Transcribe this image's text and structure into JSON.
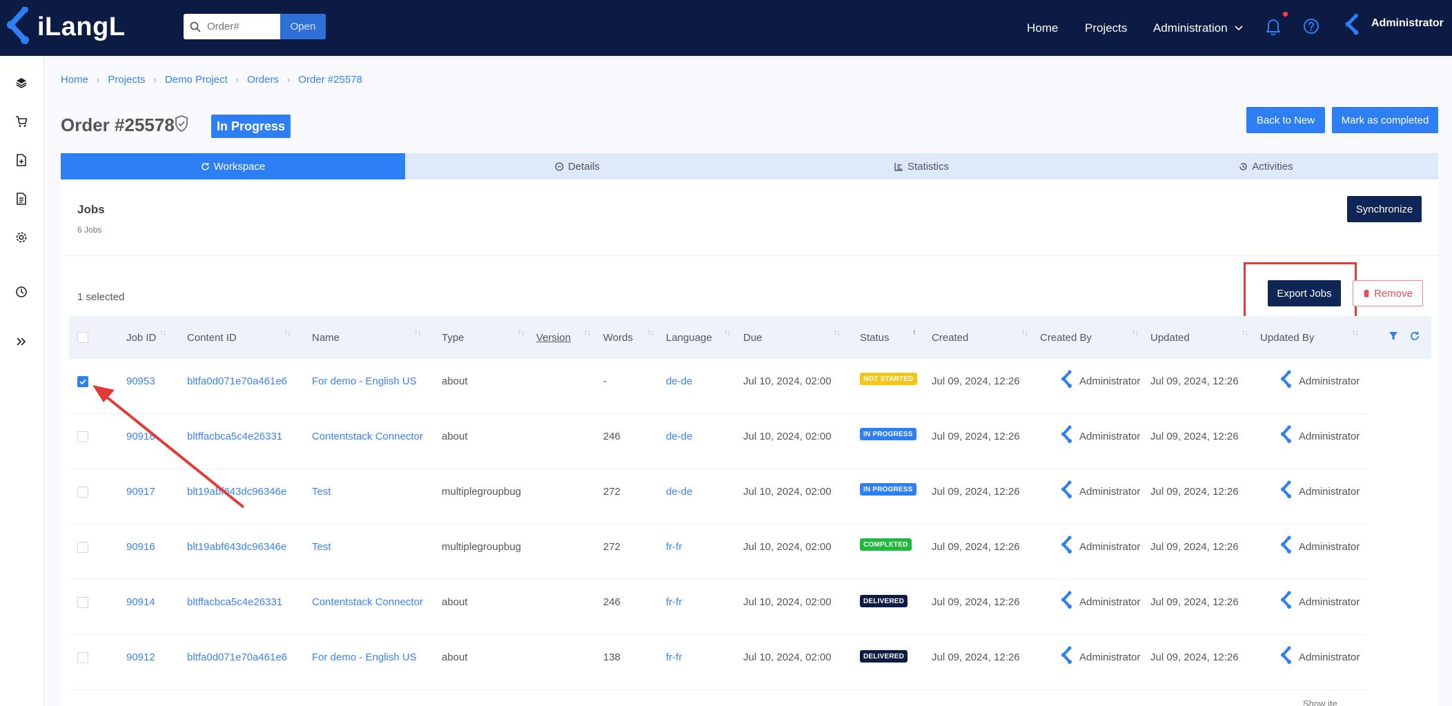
{
  "brand": {
    "name": "iLangL"
  },
  "search": {
    "placeholder": "Order#",
    "button": "Open"
  },
  "nav": {
    "home": "Home",
    "projects": "Projects",
    "administration": "Administration",
    "user": "Administrator"
  },
  "sidebar": {
    "icons": [
      "layers-icon",
      "cart-icon",
      "file-add-icon",
      "document-icon",
      "settings-icon",
      "clock-icon",
      "expand-icon"
    ]
  },
  "breadcrumb": [
    "Home",
    "Projects",
    "Demo Project",
    "Orders",
    "Order #25578"
  ],
  "order": {
    "title": "Order #25578",
    "status": "In Progress"
  },
  "actions": {
    "back_to_new": "Back to New",
    "mark_completed": "Mark as completed"
  },
  "tabs": [
    {
      "label": "Workspace",
      "icon": "sync-icon",
      "active": true
    },
    {
      "label": "Details",
      "icon": "circle-minus-icon",
      "active": false
    },
    {
      "label": "Statistics",
      "icon": "chart-icon",
      "active": false
    },
    {
      "label": "Activities",
      "icon": "history-icon",
      "active": false
    }
  ],
  "jobs": {
    "title": "Jobs",
    "count": "6 Jobs",
    "synchronize": "Synchronize",
    "selected": "1 selected",
    "export": "Export Jobs",
    "remove": "Remove",
    "columns": [
      "Job ID",
      "Content ID",
      "Name",
      "Type",
      "Version",
      "Words",
      "Language",
      "Due",
      "Status",
      "Created",
      "Created By",
      "Updated",
      "Updated By"
    ],
    "rows": [
      {
        "checked": true,
        "job_id": "90953",
        "content_id": "bltfa0d071e70a461e6",
        "name": "For demo - English US",
        "type": "about",
        "words": "-",
        "language": "de-de",
        "due": "Jul 10, 2024, 02:00",
        "status": "NOT STARTED",
        "status_color": "#f5c518",
        "created": "Jul 09, 2024, 12:26",
        "created_by": "Administrator",
        "updated": "Jul 09, 2024, 12:26",
        "updated_by": "Administrator"
      },
      {
        "checked": false,
        "job_id": "90918",
        "content_id": "bltffacbca5c4e26331",
        "name": "Contentstack Connector",
        "type": "about",
        "words": "246",
        "language": "de-de",
        "due": "Jul 10, 2024, 02:00",
        "status": "IN PROGRESS",
        "status_color": "#2f7ff4",
        "created": "Jul 09, 2024, 12:26",
        "created_by": "Administrator",
        "updated": "Jul 09, 2024, 12:26",
        "updated_by": "Administrator"
      },
      {
        "checked": false,
        "job_id": "90917",
        "content_id": "blt19abf643dc96346e",
        "name": "Test",
        "type": "multiplegroupbug",
        "words": "272",
        "language": "de-de",
        "due": "Jul 10, 2024, 02:00",
        "status": "IN PROGRESS",
        "status_color": "#2f7ff4",
        "created": "Jul 09, 2024, 12:26",
        "created_by": "Administrator",
        "updated": "Jul 09, 2024, 12:26",
        "updated_by": "Administrator"
      },
      {
        "checked": false,
        "job_id": "90916",
        "content_id": "blt19abf643dc96346e",
        "name": "Test",
        "type": "multiplegroupbug",
        "words": "272",
        "language": "fr-fr",
        "due": "Jul 10, 2024, 02:00",
        "status": "COMPLETED",
        "status_color": "#1eb83a",
        "created": "Jul 09, 2024, 12:26",
        "created_by": "Administrator",
        "updated": "Jul 09, 2024, 12:26",
        "updated_by": "Administrator"
      },
      {
        "checked": false,
        "job_id": "90914",
        "content_id": "bltffacbca5c4e26331",
        "name": "Contentstack Connector",
        "type": "about",
        "words": "246",
        "language": "fr-fr",
        "due": "Jul 10, 2024, 02:00",
        "status": "DELIVERED",
        "status_color": "#0b1b44",
        "created": "Jul 09, 2024, 12:26",
        "created_by": "Administrator",
        "updated": "Jul 09, 2024, 12:26",
        "updated_by": "Administrator"
      },
      {
        "checked": false,
        "job_id": "90912",
        "content_id": "bltfa0d071e70a461e6",
        "name": "For demo - English US",
        "type": "about",
        "words": "138",
        "language": "fr-fr",
        "due": "Jul 10, 2024, 02:00",
        "status": "DELIVERED",
        "status_color": "#0b1b44",
        "created": "Jul 09, 2024, 12:26",
        "created_by": "Administrator",
        "updated": "Jul 09, 2024, 12:26",
        "updated_by": "Administrator"
      }
    ]
  },
  "footer": {
    "show_label": "Show ite"
  },
  "colors": {
    "nav_bg": "#0b1b44",
    "accent": "#2f7ff4",
    "dark_button": "#0f2555",
    "annotation": "#e53935"
  }
}
